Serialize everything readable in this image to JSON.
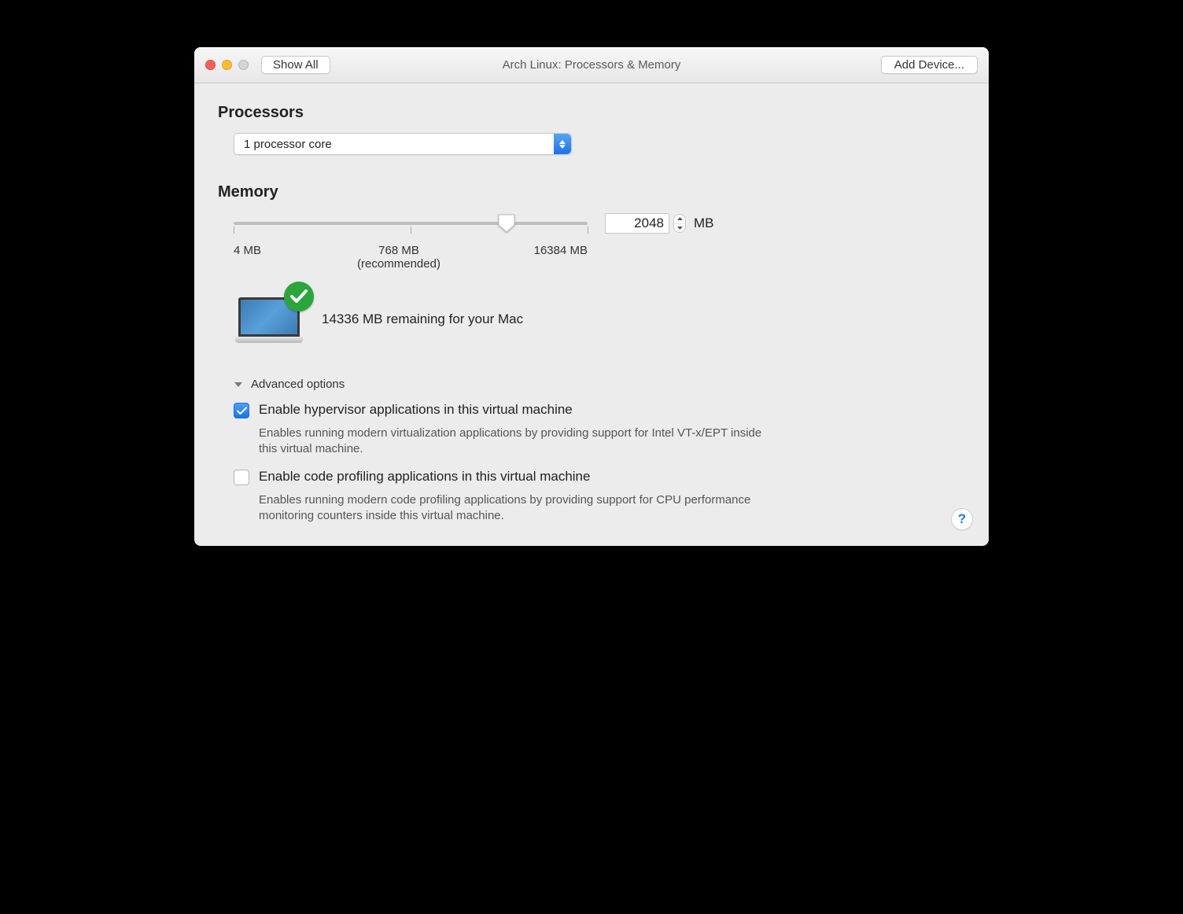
{
  "titlebar": {
    "title": "Arch Linux: Processors & Memory",
    "show_all": "Show All",
    "add_device": "Add Device..."
  },
  "processors": {
    "heading": "Processors",
    "selected": "1 processor core"
  },
  "memory": {
    "heading": "Memory",
    "value": "2048",
    "unit": "MB",
    "min_label": "4 MB",
    "mid_label": "768 MB",
    "mid_sub": "(recommended)",
    "max_label": "16384 MB",
    "remaining": "14336 MB remaining for your Mac"
  },
  "advanced": {
    "heading": "Advanced options",
    "hypervisor_label": "Enable hypervisor applications in this virtual machine",
    "hypervisor_desc": "Enables running modern virtualization applications by providing support for Intel VT-x/EPT inside this virtual machine.",
    "profiling_label": "Enable code profiling applications in this virtual machine",
    "profiling_desc": "Enables running modern code profiling applications by providing support for CPU performance monitoring counters inside this virtual machine."
  },
  "help": "?"
}
